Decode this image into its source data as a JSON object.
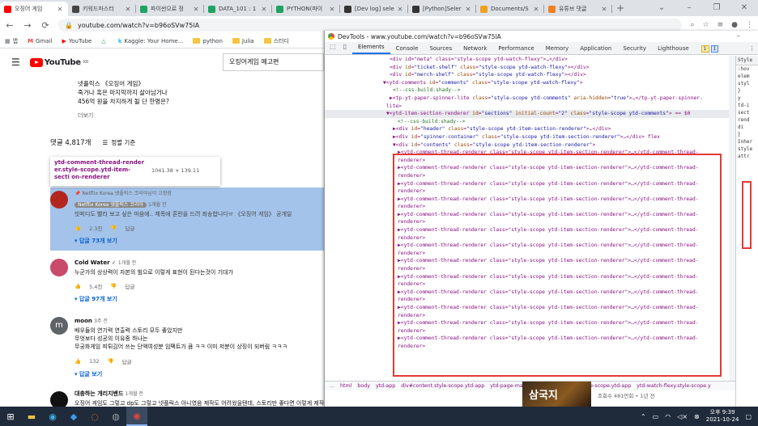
{
  "browser": {
    "tabs": [
      {
        "label": "오징어 게임",
        "icon": "youtube-icon",
        "color": "#ff0000"
      },
      {
        "label": "키워드마스터",
        "icon": "compass-icon",
        "color": "#444444"
      },
      {
        "label": "파이썬으로 정",
        "icon": "green-square-icon",
        "color": "#1ea362"
      },
      {
        "label": "DATA_101 : 1",
        "icon": "green-square-icon",
        "color": "#1ea362"
      },
      {
        "label": "PYTHON(파이",
        "icon": "green-square-icon",
        "color": "#1ea362"
      },
      {
        "label": "[Dev log] sele",
        "icon": "velog-icon",
        "color": "#333333"
      },
      {
        "label": "[Python]Seler",
        "icon": "velog-icon",
        "color": "#333333"
      },
      {
        "label": "Documents/S",
        "icon": "loading-icon",
        "color": "#f0a020"
      },
      {
        "label": "유튜브 댓글",
        "icon": "bookmark-icon",
        "color": "#f48024"
      }
    ],
    "url": "youtube.com/watch?v=b96oSVw75lA",
    "bookmarks": [
      "앱",
      "Gmail",
      "YouTube",
      "",
      "Kaggle: Your Home...",
      "python",
      "Julia",
      "스터디"
    ]
  },
  "youtube": {
    "search_value": "오징어게임 예고편",
    "logo_text": "YouTube",
    "logo_region": "KR",
    "desc_lines": [
      "넷플릭스 《오징어 게임》",
      "죽거나 혹은 마지막까지 살아남거나",
      "456억 원을 차지하게 될 단 한명은?"
    ],
    "more_label": "더보기",
    "comment_count": "댓글 4,817개",
    "sort_label": "정렬 기준",
    "tooltip_name": "ytd-comment-thread-render er.style-scope.ytd-item-secti on-renderer",
    "tooltip_dims": "1041.38 × 139.11",
    "comments": [
      {
        "pinned": "Netflix Korea 넷플릭스 코리아님이 고정함",
        "author": "Netflix Korea 넷플릭스 코리아",
        "time": "1개월 전",
        "text": "빗피디도 빨리 보고 싶은 마음에.. 제목에 혼란을 드려 죄송합니다ㅠ 《오징어 게임》 공개일",
        "likes": "2.3천",
        "reply_label": "답글",
        "replies": "답글 73개 보기",
        "avatar_color": "#b3261e"
      },
      {
        "author": "Cold Water",
        "time": "1개월 전",
        "text": "누군가의 상상력이 자본의 힘으로 이렇게 표현이 된다는것이 기대가",
        "likes": "5.4천",
        "reply_label": "답글",
        "replies": "답글 97개 보기",
        "avatar_color": "#c94a6a"
      },
      {
        "author": "moon",
        "time": "3주 전",
        "text_lines": [
          "배우들의 연기력 연출력 스토리 모두 좋았지만",
          "무엇보다 성공의 이유중 하나는",
          "무궁화게임 피튀김어 쓰는 단액여성분 임팩트가 큼 ㅋㅋ 이미 저분이 상징이 되버림 ㅋㅋㅋ"
        ],
        "likes": "132",
        "reply_label": "답글",
        "replies": "답글 보기",
        "avatar_color": "#5f6368",
        "initial": "m"
      },
      {
        "author": "대충하는 개리지밴드",
        "time": "1개월 전",
        "text": "오징어 게임도 그렇고 dp도 그렇고 넷플릭스 아니였음 제작도 어려웠을텐데, 스토리만 좋다면 이렇게 제작도 해주니까 나올 수 있어서 좋네",
        "avatar_color": "#111111"
      }
    ],
    "video": {
      "thumb_text": "삼국지",
      "meta": "조회수 481만회 • 1년 전"
    }
  },
  "devtools": {
    "title": "DevTools - www.youtube.com/watch?v=b96oSVw75lA",
    "tabs": [
      "Elements",
      "Console",
      "Sources",
      "Network",
      "Performance",
      "Memory",
      "Application",
      "Security",
      "Lighthouse"
    ],
    "active_tab": "Elements",
    "warnings": "1",
    "messages": "1",
    "dom_lines": [
      {
        "indent": 80,
        "parts": [
          [
            "t",
            "<div "
          ],
          [
            "a",
            "id"
          ],
          [
            "t",
            "="
          ],
          [
            "v",
            "\"ticket-shelf\""
          ],
          [
            "t",
            " "
          ],
          [
            "a",
            "class"
          ],
          [
            "t",
            "="
          ],
          [
            "v",
            "\"style-scope ytd-watch-flexy\""
          ],
          [
            "t",
            "></div>"
          ]
        ]
      },
      {
        "indent": 80,
        "parts": [
          [
            "t",
            "<div "
          ],
          [
            "a",
            "id"
          ],
          [
            "t",
            "="
          ],
          [
            "v",
            "\"merch-shelf\""
          ],
          [
            "t",
            " "
          ],
          [
            "a",
            "class"
          ],
          [
            "t",
            "="
          ],
          [
            "v",
            "\"style-scope ytd-watch-flexy\""
          ],
          [
            "t",
            "></div>"
          ]
        ]
      },
      {
        "indent": 72,
        "parts": [
          [
            "t",
            "▼<ytd-comments "
          ],
          [
            "a",
            "id"
          ],
          [
            "t",
            "="
          ],
          [
            "v",
            "\"comments\""
          ],
          [
            "t",
            " "
          ],
          [
            "a",
            "class"
          ],
          [
            "t",
            "="
          ],
          [
            "v",
            "\"style-scope ytd-watch-flexy\""
          ],
          [
            "t",
            ">"
          ]
        ]
      },
      {
        "indent": 84,
        "parts": [
          [
            "c",
            "<!--css-build:shady-->"
          ]
        ]
      },
      {
        "indent": 80,
        "parts": [
          [
            "t",
            "▶<tp-yt-paper-spinner-lite "
          ],
          [
            "a",
            "class"
          ],
          [
            "t",
            "="
          ],
          [
            "v",
            "\"style-scope ytd-comments\""
          ],
          [
            "t",
            " "
          ],
          [
            "a",
            "aria-hidden"
          ],
          [
            "t",
            "="
          ],
          [
            "v",
            "\"true\""
          ],
          [
            "t",
            ">…</tp-yt-paper-spinner-"
          ]
        ]
      },
      {
        "indent": 76,
        "parts": [
          [
            "t",
            "lite>"
          ]
        ]
      },
      {
        "indent": 76,
        "sel": true,
        "parts": [
          [
            "t",
            "▼<ytd-item-section-renderer "
          ],
          [
            "a",
            "id"
          ],
          [
            "t",
            "="
          ],
          [
            "v",
            "\"sections\""
          ],
          [
            "t",
            " "
          ],
          [
            "a",
            "initial-count"
          ],
          [
            "t",
            "="
          ],
          [
            "v",
            "\"2\""
          ],
          [
            "t",
            " "
          ],
          [
            "a",
            "class"
          ],
          [
            "t",
            "="
          ],
          [
            "v",
            "\"style-scope ytd-comments\""
          ],
          [
            "t",
            "> == $0"
          ]
        ]
      },
      {
        "indent": 90,
        "parts": [
          [
            "c",
            "<!--css-build:shady-->"
          ]
        ]
      },
      {
        "indent": 84,
        "parts": [
          [
            "t",
            "▶<div "
          ],
          [
            "a",
            "id"
          ],
          [
            "t",
            "="
          ],
          [
            "v",
            "\"header\""
          ],
          [
            "t",
            " "
          ],
          [
            "a",
            "class"
          ],
          [
            "t",
            "="
          ],
          [
            "v",
            "\"style-scope ytd-item-section-renderer\""
          ],
          [
            "t",
            ">…</div>"
          ]
        ]
      },
      {
        "indent": 84,
        "parts": [
          [
            "t",
            "▶<div "
          ],
          [
            "a",
            "id"
          ],
          [
            "t",
            "="
          ],
          [
            "v",
            "\"spinner-container\""
          ],
          [
            "t",
            " "
          ],
          [
            "a",
            "class"
          ],
          [
            "t",
            "="
          ],
          [
            "v",
            "\"style-scope ytd-item-section-renderer\""
          ],
          [
            "t",
            ">…</div> flex"
          ]
        ]
      },
      {
        "indent": 84,
        "parts": [
          [
            "t",
            "▼<div "
          ],
          [
            "a",
            "id"
          ],
          [
            "t",
            "="
          ],
          [
            "v",
            "\"contents\""
          ],
          [
            "t",
            " "
          ],
          [
            "a",
            "class"
          ],
          [
            "t",
            "="
          ],
          [
            "v",
            "\"style-scope ytd-item-section-renderer\""
          ],
          [
            "t",
            ">"
          ]
        ]
      }
    ],
    "thread_open": "▶<ytd-comment-thread-renderer class=\"style-scope ytd-item-section-renderer\">…</ytd-comment-thread-",
    "thread_close": "renderer>",
    "thread_count": 13,
    "breadcrumbs": [
      "...",
      "html",
      "body",
      "ytd-app",
      "div#content.style-scope.ytd-app",
      "ytd-page-manager#page-manager.style-scope.ytd-app",
      "ytd-watch-flexy.style-scope.y"
    ],
    "styles_side": [
      "Style",
      ":hov",
      "elem",
      "styl",
      "}",
      "y",
      "td-i",
      "sect",
      "rend",
      "di",
      "}",
      "Inher",
      "style",
      "attr"
    ]
  },
  "taskbar": {
    "time": "오후 9:39",
    "date": "2021-10-24"
  }
}
